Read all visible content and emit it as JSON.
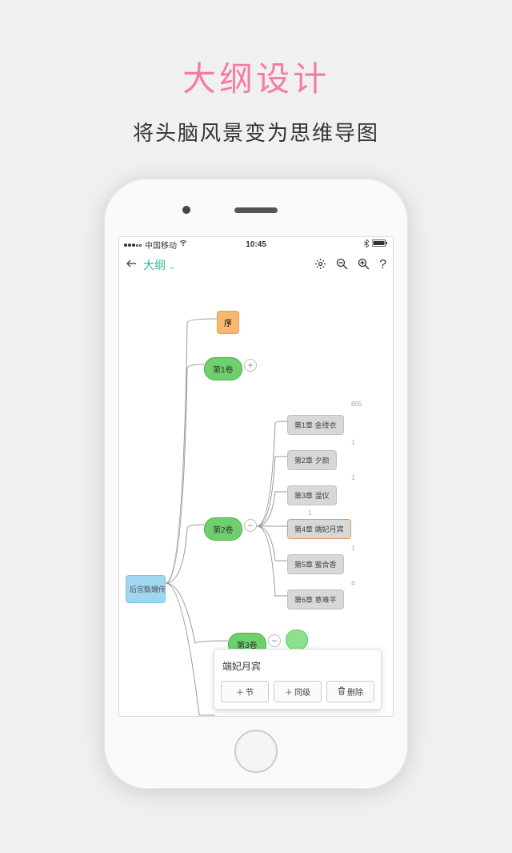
{
  "header": {
    "title": "大纲设计",
    "subtitle": "将头脑风景变为思维导图"
  },
  "status": {
    "carrier": "中国移动",
    "time": "10:45"
  },
  "toolbar": {
    "outline": "大纲"
  },
  "nodes": {
    "root": "后宫甄嬛传",
    "preface": "序",
    "vol1": "第1卷",
    "vol2": "第2卷",
    "vol3": "第3卷",
    "count805": "805",
    "chap1": "第1章 金缕衣",
    "chap2": "第2章 夕颜",
    "chap3": "第3章 温仪",
    "chap4": "第4章 端妃月宾",
    "chap5": "第5章 蜜合香",
    "chap6": "第6章 意难平",
    "small1a": "1",
    "small1b": "1",
    "small1c": "1",
    "small1d": "1",
    "small4": "4"
  },
  "popup": {
    "title": "端妃月宾",
    "add_child": "节",
    "add_sibling": "同级",
    "delete": "删除"
  }
}
